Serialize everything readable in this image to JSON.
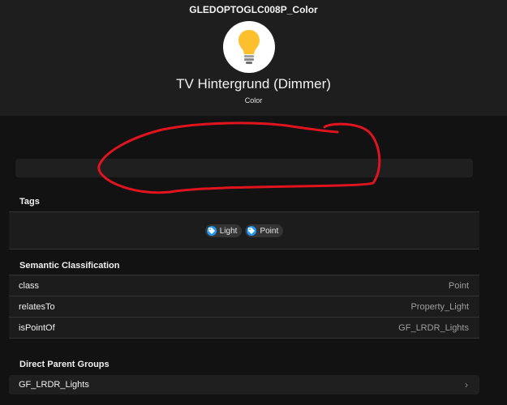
{
  "header": {
    "item_name": "GLEDOPTOGLC008P_Color",
    "icon": "lightbulb-icon",
    "label": "TV Hintergrund (Dimmer)",
    "type": "Color"
  },
  "tags": {
    "title": "Tags",
    "items": [
      {
        "label": "Light",
        "icon": "tag-icon"
      },
      {
        "label": "Point",
        "icon": "tag-icon"
      }
    ]
  },
  "semantic": {
    "title": "Semantic Classification",
    "rows": [
      {
        "key": "class",
        "value": "Point"
      },
      {
        "key": "relatesTo",
        "value": "Property_Light"
      },
      {
        "key": "isPointOf",
        "value": "GF_LRDR_Lights"
      }
    ]
  },
  "parents": {
    "title": "Direct Parent Groups",
    "items": [
      {
        "label": "GF_LRDR_Lights"
      }
    ]
  },
  "colors": {
    "background": "#121212",
    "header": "#1e1e1e",
    "tag_icon": "#2196f3",
    "bulb": "#fcc02e",
    "annotation": "#e0141e"
  }
}
